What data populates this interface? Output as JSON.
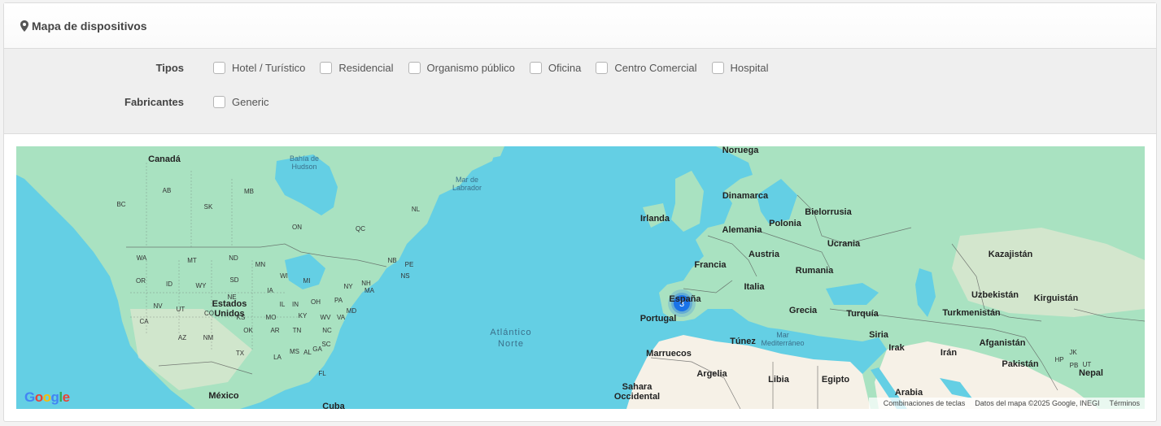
{
  "panel": {
    "title": "Mapa de dispositivos",
    "icon": "map-marker-icon"
  },
  "filters": {
    "tipos_label": "Tipos",
    "tipos": [
      "Hotel / Turístico",
      "Residencial",
      "Organismo público",
      "Oficina",
      "Centro Comercial",
      "Hospital"
    ],
    "fabricantes_label": "Fabricantes",
    "fabricantes": [
      "Generic"
    ]
  },
  "map": {
    "colors": {
      "water": "#64cfe4",
      "land": "#a9e2c1",
      "desert": "#f6f1e7",
      "cluster": "#1a73e8"
    },
    "cluster_count": "3",
    "labels": {
      "canada": "Canadá",
      "hudson": [
        "Bahía de",
        "Hudson"
      ],
      "labrador": [
        "Mar de",
        "Labrador"
      ],
      "usa": [
        "Estados",
        "Unidos"
      ],
      "mexico": "México",
      "cuba": "Cuba",
      "atlantic": [
        "Atlántico",
        "Norte"
      ],
      "noruega": "Noruega",
      "dinamarca": "Dinamarca",
      "irlanda": "Irlanda",
      "bielorrusia": "Bielorrusia",
      "polonia": "Polonia",
      "alemania": "Alemania",
      "ucrania": "Ucrania",
      "kazajistan": "Kazajistán",
      "francia": "Francia",
      "austria": "Austria",
      "rumania": "Rumania",
      "italia": "Italia",
      "espana": "España",
      "portugal": "Portugal",
      "grecia": "Grecia",
      "turquia": "Turquía",
      "uzbekistan": "Uzbekistán",
      "kirguistan": "Kirguistán",
      "turkmenistan": "Turkmenistán",
      "tunez": "Túnez",
      "mar_med": [
        "Mar",
        "Mediterráneo"
      ],
      "siria": "Siria",
      "afganistan": "Afganistán",
      "marruecos": "Marruecos",
      "irak": "Irak",
      "iran": "Irán",
      "argelia": "Argelia",
      "libia": "Libia",
      "egipto": "Egipto",
      "pakistan": "Pakistán",
      "nepal": "Nepal",
      "sahara": [
        "Sahara",
        "Occidental"
      ],
      "arabia": "Arabia"
    },
    "regions": [
      "AB",
      "BC",
      "SK",
      "MB",
      "QC",
      "ON",
      "NL",
      "NB",
      "PE",
      "NS",
      "WA",
      "MT",
      "ND",
      "MN",
      "WI",
      "MI",
      "SD",
      "OR",
      "ID",
      "WY",
      "NE",
      "IA",
      "IL",
      "IN",
      "OH",
      "PA",
      "NY",
      "NH",
      "MA",
      "NV",
      "UT",
      "CO",
      "KS",
      "MO",
      "KY",
      "WV",
      "VA",
      "MD",
      "CA",
      "AZ",
      "NM",
      "OK",
      "AR",
      "TN",
      "NC",
      "SC",
      "TX",
      "LA",
      "MS",
      "AL",
      "GA",
      "FL",
      "JK",
      "HP",
      "PB",
      "UT"
    ],
    "footer": {
      "shortcuts": "Combinaciones de teclas",
      "data": "Datos del mapa ©2025 Google, INEGI",
      "terms": "Términos"
    },
    "logo": "Google"
  }
}
